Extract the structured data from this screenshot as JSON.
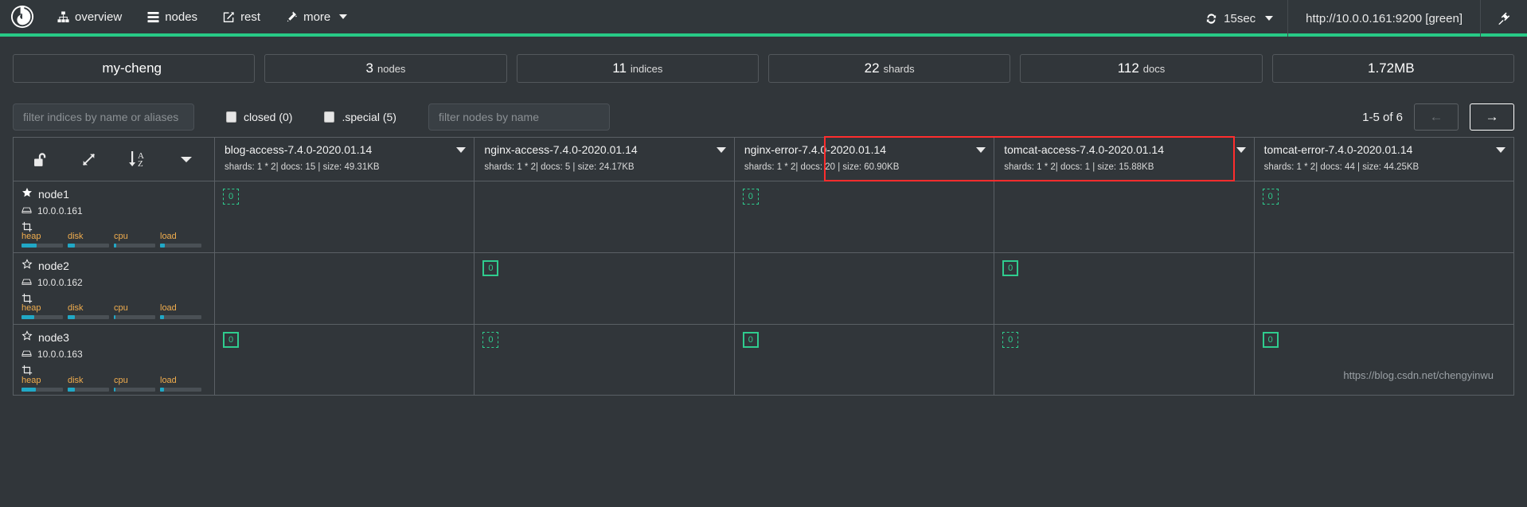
{
  "navbar": {
    "brand_icon": "cerebro-logo-icon",
    "items": [
      {
        "label": "overview",
        "icon": "sitemap-icon"
      },
      {
        "label": "nodes",
        "icon": "server-list-icon"
      },
      {
        "label": "rest",
        "icon": "edit-square-icon"
      },
      {
        "label": "more",
        "icon": "magic-wand-icon",
        "has_caret": true
      }
    ],
    "refresh": {
      "label": "15sec",
      "icon": "refresh-icon",
      "has_caret": true
    },
    "cluster_url": "http://10.0.0.161:9200 [green]",
    "disconnect_icon": "plug-icon",
    "accent_color": "#27ca86"
  },
  "stats": [
    {
      "value": "my-cheng",
      "unit": ""
    },
    {
      "value": "3",
      "unit": "nodes"
    },
    {
      "value": "11",
      "unit": "indices"
    },
    {
      "value": "22",
      "unit": "shards"
    },
    {
      "value": "112",
      "unit": "docs"
    },
    {
      "value": "1.72MB",
      "unit": ""
    }
  ],
  "filters": {
    "indices_placeholder": "filter indices by name or aliases",
    "indices_value": "",
    "closed_label": "closed (0)",
    "closed_checked": false,
    "special_label": ".special (5)",
    "special_checked": false,
    "nodes_placeholder": "filter nodes by name",
    "nodes_value": ""
  },
  "pagination": {
    "range_label": "1-5 of 6",
    "prev_label": "←",
    "next_label": "→",
    "prev_disabled": true,
    "next_disabled": false
  },
  "toolbar": {
    "unlock_icon": "unlock-icon",
    "expand_icon": "expand-arrows-icon",
    "sort_az_icon": "sort-alpha-down-icon",
    "caret_icon": "chevron-down-icon"
  },
  "nodes": [
    {
      "name": "node1",
      "icon": "star-filled-icon",
      "ip": "10.0.0.161",
      "ip_icon": "hdd-icon",
      "role_icon": "data-node-icon",
      "gauges": [
        {
          "label": "heap",
          "pct": 36
        },
        {
          "label": "disk",
          "pct": 18
        },
        {
          "label": "cpu",
          "pct": 5
        },
        {
          "label": "load",
          "pct": 12
        }
      ]
    },
    {
      "name": "node2",
      "icon": "star-outline-icon",
      "ip": "10.0.0.162",
      "ip_icon": "hdd-icon",
      "role_icon": "data-node-icon",
      "gauges": [
        {
          "label": "heap",
          "pct": 30
        },
        {
          "label": "disk",
          "pct": 18
        },
        {
          "label": "cpu",
          "pct": 4
        },
        {
          "label": "load",
          "pct": 10
        }
      ]
    },
    {
      "name": "node3",
      "icon": "star-outline-icon",
      "ip": "10.0.0.163",
      "ip_icon": "hdd-icon",
      "role_icon": "data-node-icon",
      "gauges": [
        {
          "label": "heap",
          "pct": 34
        },
        {
          "label": "disk",
          "pct": 18
        },
        {
          "label": "cpu",
          "pct": 4
        },
        {
          "label": "load",
          "pct": 10
        }
      ]
    }
  ],
  "indices": [
    {
      "name": "blog-access-7.4.0-2020.01.14",
      "meta": "shards: 1 * 2| docs: 15 | size: 49.31KB",
      "highlighted": false,
      "shards": [
        [
          {
            "id": "0",
            "type": "replica"
          }
        ],
        [],
        [
          {
            "id": "0",
            "type": "primary"
          }
        ]
      ]
    },
    {
      "name": "nginx-access-7.4.0-2020.01.14",
      "meta": "shards: 1 * 2| docs: 5 | size: 24.17KB",
      "highlighted": false,
      "shards": [
        [],
        [
          {
            "id": "0",
            "type": "primary"
          }
        ],
        [
          {
            "id": "0",
            "type": "replica"
          }
        ]
      ]
    },
    {
      "name": "nginx-error-7.4.0-2020.01.14",
      "meta": "shards: 1 * 2| docs: 20 | size: 60.90KB",
      "highlighted": false,
      "shards": [
        [
          {
            "id": "0",
            "type": "replica"
          }
        ],
        [],
        [
          {
            "id": "0",
            "type": "primary"
          }
        ]
      ]
    },
    {
      "name": "tomcat-access-7.4.0-2020.01.14",
      "meta": "shards: 1 * 2| docs: 1 | size: 15.88KB",
      "highlighted": true,
      "shards": [
        [],
        [
          {
            "id": "0",
            "type": "primary"
          }
        ],
        [
          {
            "id": "0",
            "type": "replica"
          }
        ]
      ]
    },
    {
      "name": "tomcat-error-7.4.0-2020.01.14",
      "meta": "shards: 1 * 2| docs: 44 | size: 44.25KB",
      "highlighted": true,
      "shards": [
        [
          {
            "id": "0",
            "type": "replica"
          }
        ],
        [],
        [
          {
            "id": "0",
            "type": "primary"
          }
        ]
      ]
    }
  ],
  "watermark": "https://blog.csdn.net/chengyinwu",
  "colors": {
    "accent_green": "#27ca86",
    "shard_green": "#2fcc8e",
    "highlight_red": "#ff2d2d",
    "gauge_blue": "#21a8c6",
    "gauge_label": "#f0ad4e",
    "background": "#31363a"
  }
}
